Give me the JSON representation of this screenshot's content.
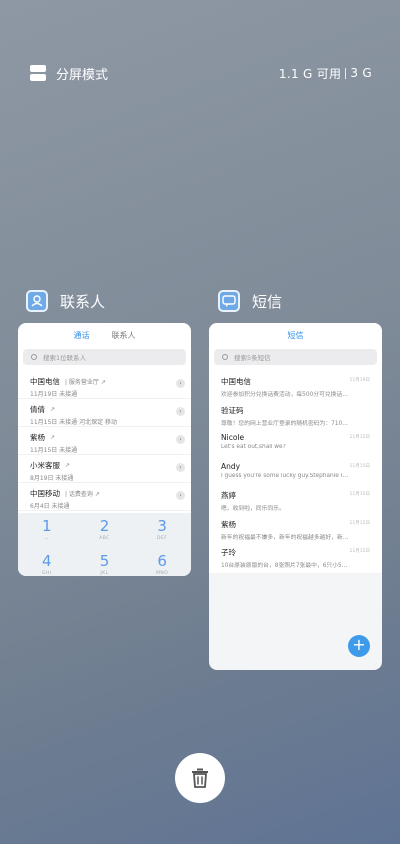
{
  "topbar": {
    "split_label": "分屏模式",
    "mem_available": "1.1 G 可用",
    "mem_total": "3 G"
  },
  "apps": {
    "contacts": {
      "title": "联系人",
      "tab_recent": "通话",
      "tab_contacts": "联系人",
      "search_placeholder": "搜索1位联系人",
      "rows": [
        {
          "name": "中国电信",
          "tag": "| 服务营业厅 ↗",
          "detail": "11月19日 未接通"
        },
        {
          "name": "倩倩",
          "tag": "↗",
          "detail": "11月15日 未接通 河北保定 移动"
        },
        {
          "name": "紫杨",
          "tag": "↗",
          "detail": "11月15日 未接通"
        },
        {
          "name": "小米客服",
          "tag": "↗",
          "detail": "8月19日 未接通"
        },
        {
          "name": "中国移动",
          "tag": "| 话费查询 ↗",
          "detail": "6月4日 未接通"
        }
      ],
      "keypad": [
        {
          "digit": "1",
          "sub": "ㅡ"
        },
        {
          "digit": "2",
          "sub": "ABC"
        },
        {
          "digit": "3",
          "sub": "DEF"
        },
        {
          "digit": "4",
          "sub": "GHI"
        },
        {
          "digit": "5",
          "sub": "JKL"
        },
        {
          "digit": "6",
          "sub": "MNO"
        }
      ]
    },
    "sms": {
      "title": "短信",
      "header": "短信",
      "search_placeholder": "搜索5条短信",
      "messages": [
        {
          "name": "中国电信",
          "preview": "欢迎参加积分兑换话费活动，每500分可兑换话费...",
          "time": "11月19日"
        },
        {
          "name": "验证码",
          "preview": "尊敬！您的网上营业厅登录的随机密码为：710679...",
          "time": ""
        },
        {
          "name": "Nicole",
          "preview": "Let's eat out,shall we?",
          "time": "11月15日"
        },
        {
          "name": "Andy",
          "preview": "I guess you're some lucky guy.Stephanie is a n...",
          "time": "11月15日"
        },
        {
          "name": "燕婷",
          "preview": "嗯，收到啦，同乐同乐。",
          "time": "11月15日"
        },
        {
          "name": "紫杨",
          "preview": "新年的祝福最不嫌多，新年的祝福越多越好，新年...",
          "time": "11月15日"
        },
        {
          "name": "子玲",
          "preview": "10台原装原版的台，8张照片7张最中，6只小5只...",
          "time": "11月15日"
        }
      ],
      "fab_label": "+"
    }
  },
  "colors": {
    "accent": "#2e8fe8",
    "fab": "#3d9be9"
  }
}
